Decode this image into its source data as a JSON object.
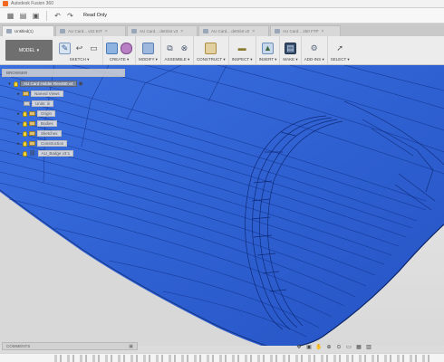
{
  "window": {
    "title": "Autodesk Fusion 360"
  },
  "quick_access": {
    "read_only_label": "Read Only"
  },
  "tabs": [
    {
      "label": "Untitled(1)"
    },
    {
      "label": "AU Card... v22 EIT"
    },
    {
      "label": "AU Card... detSlot v3"
    },
    {
      "label": "AU Card... detSlot v2"
    },
    {
      "label": "AU Card... 250 FTP"
    }
  ],
  "toolbar": {
    "workspace_label": "MODEL",
    "groups": [
      {
        "label": "SKETCH ▾"
      },
      {
        "label": "CREATE ▾"
      },
      {
        "label": "MODIFY ▾"
      },
      {
        "label": "ASSEMBLE ▾"
      },
      {
        "label": "CONSTRUCT ▾"
      },
      {
        "label": "INSPECT ▾"
      },
      {
        "label": "INSERT ▾"
      },
      {
        "label": "MAKE ▾"
      },
      {
        "label": "ADD-INS ▾"
      },
      {
        "label": "SELECT ▾"
      }
    ]
  },
  "browser": {
    "header": "BROWSER",
    "items": [
      {
        "label": "AU Card Holder Rev460 v4"
      },
      {
        "label": "Named Views"
      },
      {
        "label": "Units: in"
      },
      {
        "label": "Origin"
      },
      {
        "label": "Bodies"
      },
      {
        "label": "Sketches"
      },
      {
        "label": "Construction"
      },
      {
        "label": "AU_Badge v3:1"
      }
    ]
  },
  "comments": {
    "label": "COMMENTS"
  },
  "colors": {
    "model_blue": "#2a5fd0",
    "wire_dark": "#0e2e86",
    "accent_orange": "#f26a21"
  }
}
